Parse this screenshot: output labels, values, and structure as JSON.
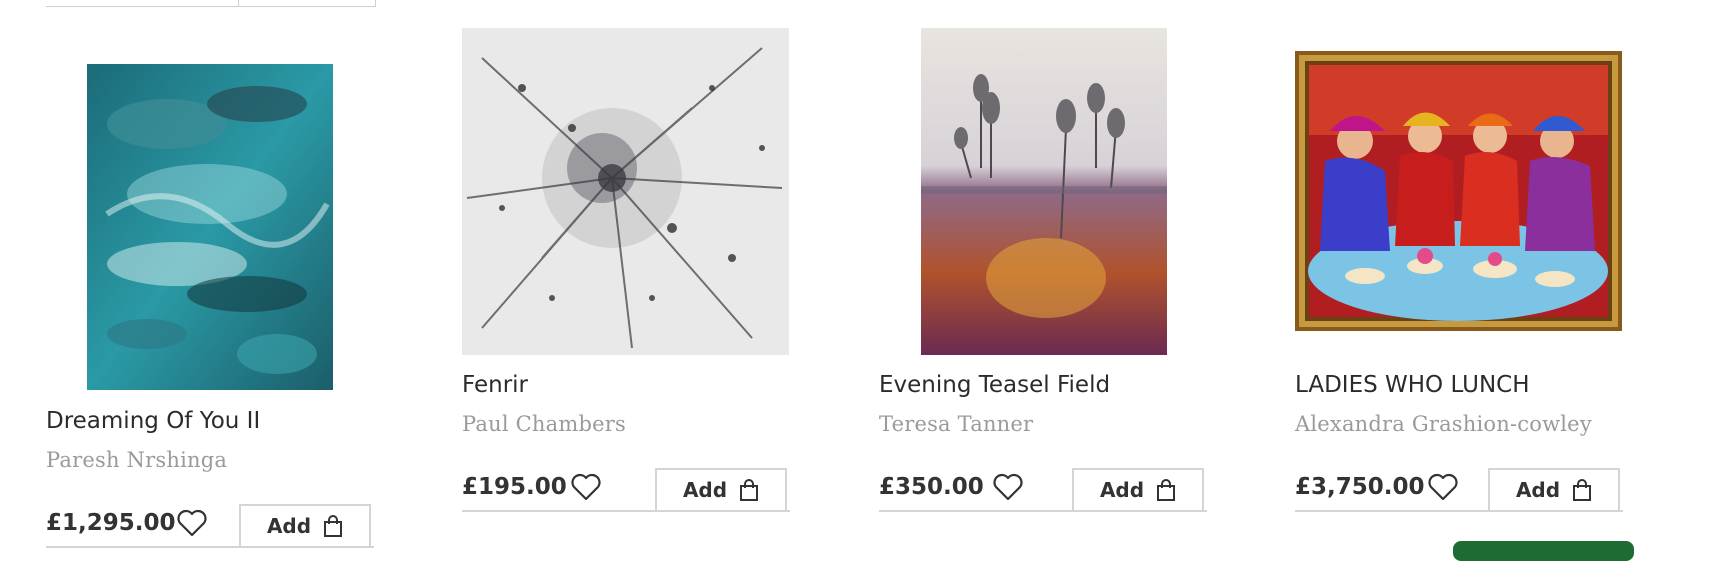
{
  "products": [
    {
      "title": "Dreaming Of You II",
      "artist": "Paresh Nrshinga",
      "price": "£1,295.00",
      "add_label": "Add",
      "art_icon": "painting-abstract-teal"
    },
    {
      "title": "Fenrir",
      "artist": "Paul Chambers",
      "price": "£195.00",
      "add_label": "Add",
      "art_icon": "painting-splatter-grey"
    },
    {
      "title": "Evening Teasel Field",
      "artist": "Teresa Tanner",
      "price": "£350.00",
      "add_label": "Add",
      "art_icon": "painting-teasel-field"
    },
    {
      "title": "LADIES WHO LUNCH",
      "artist": "Alexandra Grashion-cowley",
      "price": "£3,750.00",
      "add_label": "Add",
      "art_icon": "painting-ladies-lunch-framed"
    }
  ],
  "colors": {
    "text_dark": "#2b2b2b",
    "artist_grey": "#9a9a9a",
    "border": "#d5d5d5",
    "accent_green": "#1f6b34"
  }
}
